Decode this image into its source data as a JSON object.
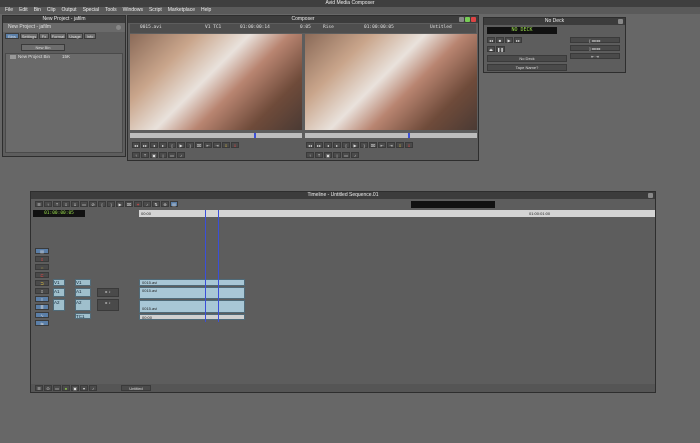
{
  "app": {
    "title": "Avid Media Composer",
    "menus": [
      "File",
      "Edit",
      "Bin",
      "Clip",
      "Output",
      "Special",
      "Tools",
      "Windows",
      "Script",
      "Marketplace",
      "Help"
    ]
  },
  "project": {
    "window_title": "New Project - jafilm",
    "header": "New Project - jafilm",
    "tabs": [
      "Bins",
      "Settings",
      "Fx",
      "Format",
      "Usage",
      "Info"
    ],
    "new_bin_label": "New Bin",
    "bins": [
      {
        "name": "New Project Bin",
        "size": "15K"
      }
    ]
  },
  "composer": {
    "title": "Composer",
    "source": {
      "clip": "0015.avi",
      "track": "V1 TC1",
      "timecode": "01:00:00:14"
    },
    "record": {
      "duration": "0:05",
      "clip": "Rise",
      "timecode": "01:00:00:05",
      "sequence": "Untitled"
    }
  },
  "deck": {
    "title": "No Deck",
    "status": "NO DECK",
    "deck_select": "No Deck",
    "tape_label": "Tape Name?"
  },
  "timeline": {
    "title": "Timeline - Untitled Sequence.01",
    "timecode": "01:00:00:05",
    "ruler_start": "00:00",
    "ruler_mark": "01:00:01:00",
    "tracks": [
      {
        "source": "V1",
        "record": "V1",
        "clip": "0015.avi"
      },
      {
        "source": "A1",
        "record": "A1",
        "clip": "0015.avi"
      },
      {
        "source": "A2",
        "record": "A2",
        "clip": "0015.avi"
      },
      {
        "source": "",
        "record": "TC1",
        "clip": "00:00"
      }
    ],
    "bottom_select": "Untitled"
  },
  "colors": {
    "accent_green": "#9ade4c",
    "clip_blue": "#a8c7d6",
    "playhead_blue": "#3b4fd9"
  }
}
